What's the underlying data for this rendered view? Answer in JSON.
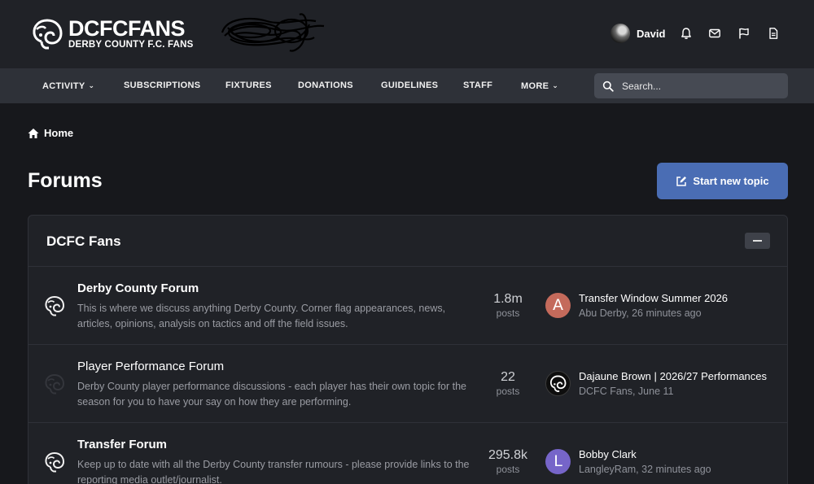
{
  "header": {
    "logo_title": "DCFCFANS",
    "logo_subtitle": "DERBY COUNTY F.C. FANS",
    "username": "David"
  },
  "nav": {
    "items": [
      {
        "label": "ACTIVITY",
        "has_dropdown": true
      },
      {
        "label": "SUBSCRIPTIONS",
        "has_dropdown": false
      },
      {
        "label": "FIXTURES",
        "has_dropdown": false
      },
      {
        "label": "DONATIONS",
        "has_dropdown": false
      },
      {
        "label": "GUIDELINES",
        "has_dropdown": false
      },
      {
        "label": "STAFF",
        "has_dropdown": false
      },
      {
        "label": "MORE",
        "has_dropdown": true
      }
    ],
    "search_placeholder": "Search..."
  },
  "breadcrumb": {
    "home": "Home"
  },
  "page": {
    "title": "Forums",
    "new_topic_label": "Start new topic"
  },
  "category": {
    "title": "DCFC Fans",
    "forums": [
      {
        "name": "Derby County Forum",
        "description": "This is where we discuss anything Derby County. Corner flag appearances, news, articles, opinions, analysis on tactics and off the field issues.",
        "stat_value": "1.8m",
        "stat_label": "posts",
        "last_title": "Transfer Window Summer 2026",
        "last_meta": "Abu Derby, 26 minutes ago",
        "avatar_letter": "A",
        "avatar_color": "#c46a5b",
        "unread": true
      },
      {
        "name": "Player Performance Forum",
        "description": "Derby County player performance discussions - each player has their own topic for the season for you to have your say on how they are performing.",
        "stat_value": "22",
        "stat_label": "posts",
        "last_title": "Dajaune Brown | 2026/27 Performances",
        "last_meta": "DCFC Fans, June 11",
        "avatar_letter": "",
        "avatar_color": "#0e0e0e",
        "unread": false
      },
      {
        "name": "Transfer Forum",
        "description": "Keep up to date with all the Derby County transfer rumours - please provide links to the reporting media outlet/journalist.",
        "stat_value": "295.8k",
        "stat_label": "posts",
        "last_title": "Bobby Clark",
        "last_meta": "LangleyRam, 32 minutes ago",
        "avatar_letter": "L",
        "avatar_color": "#7665c9",
        "unread": true
      }
    ]
  },
  "colors": {
    "accent": "#4a6db4",
    "background": "#17181c",
    "header_bg": "#202227",
    "nav_bg": "#2e3138"
  }
}
